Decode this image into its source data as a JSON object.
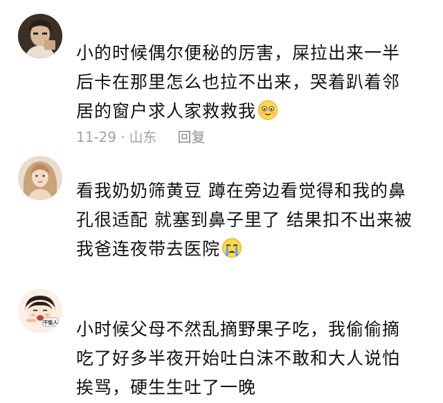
{
  "comments": [
    {
      "text": "小的时候偶尔便秘的厉害，屎拉出来一半\n后卡在那里怎么也拉不出来，哭着趴着邻\n居的窗户求人家救救我",
      "emoji": "blushing-smile-emoji",
      "date": "11-29",
      "separator": "·",
      "location": "山东",
      "reply_label": "回复"
    },
    {
      "text": "看我奶奶筛黄豆 蹲在旁边看觉得和我的鼻\n孔很适配 就塞到鼻子里了 结果扣不出来被\n我爸连夜带去医院",
      "emoji": "crying-emoji"
    },
    {
      "text": "小时候父母不然乱摘野果子吃，我偷偷摘\n吃了好多半夜开始吐白沫不敢和大人说怕\n挨骂，硬生生吐了一晚",
      "avatar_badge": "干饭人"
    }
  ],
  "colors": {
    "text": "#111111",
    "meta": "#a2a2a2",
    "background": "#ffffff"
  }
}
